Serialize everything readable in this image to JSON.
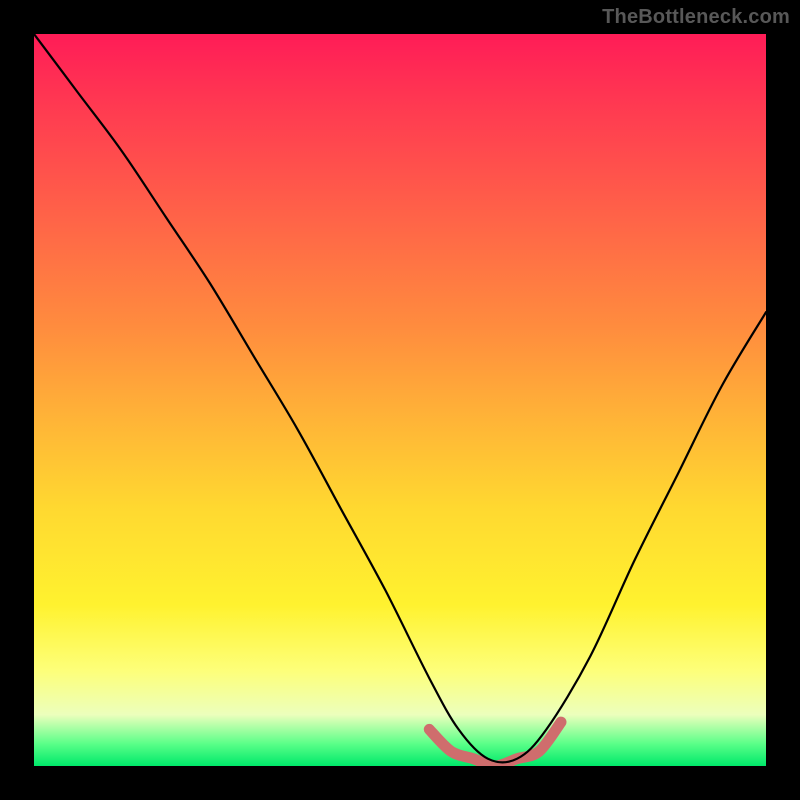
{
  "watermark": "TheBottleneck.com",
  "chart_data": {
    "type": "line",
    "title": "",
    "xlabel": "",
    "ylabel": "",
    "xlim": [
      0,
      100
    ],
    "ylim": [
      0,
      100
    ],
    "grid": false,
    "legend": false,
    "annotations": [],
    "series": [
      {
        "name": "bottleneck-curve",
        "color": "#000000",
        "x": [
          0,
          6,
          12,
          18,
          24,
          30,
          36,
          42,
          48,
          54,
          58,
          62,
          66,
          70,
          76,
          82,
          88,
          94,
          100
        ],
        "values": [
          100,
          92,
          84,
          75,
          66,
          56,
          46,
          35,
          24,
          12,
          5,
          1,
          1,
          5,
          15,
          28,
          40,
          52,
          62
        ]
      },
      {
        "name": "optimal-range-highlight",
        "color": "#cf6d6d",
        "x": [
          54,
          57,
          60,
          63,
          66,
          69,
          72
        ],
        "values": [
          5,
          2,
          1,
          0,
          1,
          2,
          6
        ]
      }
    ],
    "background_gradient": {
      "direction": "vertical",
      "stops": [
        {
          "pos": 0,
          "color": "#ff1c57"
        },
        {
          "pos": 25,
          "color": "#ff6348"
        },
        {
          "pos": 53,
          "color": "#ffb537"
        },
        {
          "pos": 78,
          "color": "#fff22f"
        },
        {
          "pos": 93,
          "color": "#ecffbc"
        },
        {
          "pos": 100,
          "color": "#00e86a"
        }
      ]
    }
  }
}
